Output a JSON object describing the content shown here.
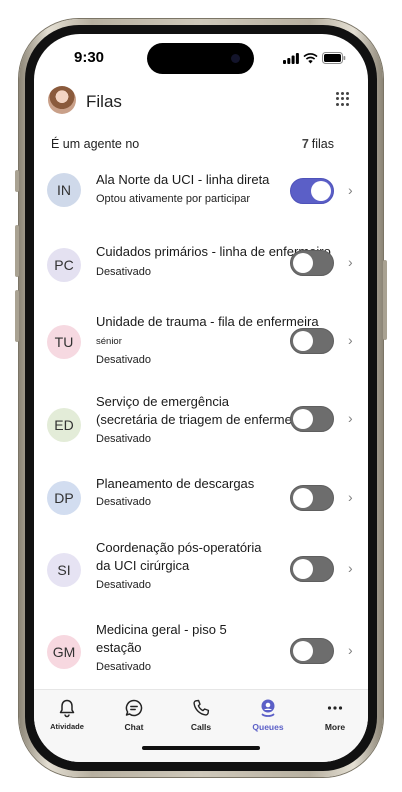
{
  "status_bar": {
    "time": "9:30"
  },
  "header": {
    "title": "Filas"
  },
  "subheader": {
    "agent_text": "É um agente no",
    "count": "7",
    "count_suffix": "filas"
  },
  "queues": [
    {
      "initials": "IN",
      "name": "Ala Norte da UCI - linha direta",
      "status": "Optou ativamente por participar",
      "toggle_on": true,
      "badge_color": "#cfd9ea"
    },
    {
      "initials": "PC",
      "name": "Cuidados primários - linha de enfermeiro",
      "status": "Desativado",
      "toggle_on": false,
      "badge_color": "#e4e1f1"
    },
    {
      "initials": "TU",
      "name": "Unidade de trauma - fila de enfermeira",
      "name_extra": "sénior",
      "status": "Desativado",
      "toggle_on": false,
      "badge_color": "#f6d9e1"
    },
    {
      "initials": "ED",
      "name": "Serviço de emergência",
      "name_line2": "(secretária de triagem de enfermeiras)",
      "status": "Desativado",
      "toggle_on": false,
      "badge_color": "#e3ecd8"
    },
    {
      "initials": "DP",
      "name": "Planeamento de descargas",
      "status": "Desativado",
      "toggle_on": false,
      "badge_color": "#d2ddf0"
    },
    {
      "initials": "SI",
      "name": "Coordenação pós-operatória",
      "name_line2": "da UCI cirúrgica",
      "status": "Desativado",
      "toggle_on": false,
      "badge_color": "#e6e3f3"
    },
    {
      "initials": "GM",
      "name": "Medicina geral - piso 5",
      "name_line2": "estação",
      "status": "Desativado",
      "toggle_on": false,
      "badge_color": "#f7d8e0"
    }
  ],
  "tabs": [
    {
      "label": "Atividade",
      "icon": "bell-icon",
      "active": false
    },
    {
      "label": "Chat",
      "icon": "chat-icon",
      "active": false
    },
    {
      "label": "Calls",
      "icon": "phone-icon",
      "active": false
    },
    {
      "label": "Queues",
      "icon": "queues-icon",
      "active": true
    },
    {
      "label": "More",
      "icon": "more-icon",
      "active": false
    }
  ],
  "colors": {
    "accent": "#5b5fc7",
    "toggle_off": "#6d6d6d"
  }
}
